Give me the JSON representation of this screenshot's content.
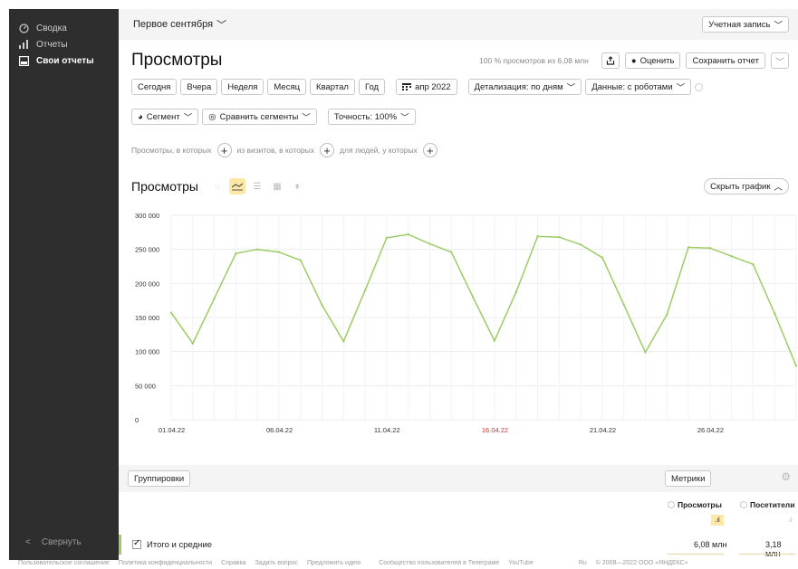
{
  "sidebar": {
    "items": [
      {
        "label": "Сводка",
        "icon": "dashboard-icon"
      },
      {
        "label": "Отчеты",
        "icon": "bar-chart-icon"
      },
      {
        "label": "Свои отчеты",
        "icon": "custom-report-icon"
      }
    ],
    "collapse_label": "Свернуть"
  },
  "header": {
    "period": "Первое сентября",
    "account_label": "Учетная запись"
  },
  "report": {
    "title": "Просмотры",
    "views_note": "100 % просмотров из 6,08 млн",
    "rate_label": "Оценить",
    "save_label": "Сохранить отчет"
  },
  "filters": {
    "periods": [
      "Сегодня",
      "Вчера",
      "Неделя",
      "Месяц",
      "Квартал",
      "Год"
    ],
    "date_label": "апр 2022",
    "detail_label": "Детализация: по дням",
    "data_label": "Данные: с роботами",
    "segment_label": "Сегмент",
    "compare_label": "Сравнить сегменты",
    "accuracy_label": "Точность: 100%",
    "cond_views": "Просмотры, в которых",
    "cond_visits": "из визитов, в которых",
    "cond_people": "для людей, у которых"
  },
  "chart_header": {
    "title": "Просмотры",
    "hide_label": "Скрыть график"
  },
  "chart_data": {
    "type": "line",
    "x": [
      "01.04.22",
      "02.04.22",
      "03.04.22",
      "04.04.22",
      "05.04.22",
      "06.04.22",
      "07.04.22",
      "08.04.22",
      "09.04.22",
      "10.04.22",
      "11.04.22",
      "12.04.22",
      "13.04.22",
      "14.04.22",
      "15.04.22",
      "16.04.22",
      "17.04.22",
      "18.04.22",
      "19.04.22",
      "20.04.22",
      "21.04.22",
      "22.04.22",
      "23.04.22",
      "24.04.22",
      "25.04.22",
      "26.04.22",
      "27.04.22",
      "28.04.22",
      "29.04.22",
      "30.04.22"
    ],
    "values": [
      157000,
      112000,
      178000,
      244000,
      250000,
      246000,
      234000,
      168000,
      115000,
      190000,
      267000,
      272000,
      258000,
      246000,
      180000,
      116000,
      187000,
      269000,
      268000,
      257000,
      238000,
      169000,
      99000,
      154000,
      253000,
      252000,
      240000,
      228000,
      156000,
      79000
    ],
    "x_tick_labels": [
      "01.04.22",
      "06.04.22",
      "11.04.22",
      "16.04.22",
      "21.04.22",
      "26.04.22"
    ],
    "highlight_tick": "16.04.22",
    "y_ticks": [
      "0",
      "50 000",
      "100 000",
      "150 000",
      "200 000",
      "250 000",
      "300 000"
    ],
    "ylim": [
      0,
      300000
    ],
    "grid": true,
    "line_color": "#9ccc65",
    "highlight_color": "#d32f2f"
  },
  "table": {
    "groupings_label": "Группировки",
    "metrics_label": "Метрики",
    "col_views": "Просмотры",
    "col_visitors": "Посетители",
    "totals_label": "Итого и средние",
    "total_views": "6,08 млн",
    "total_visitors": "3,18 млн"
  },
  "footer": {
    "links": [
      "Пользовательское соглашение",
      "Политика конфиденциальности",
      "Справка",
      "Задать вопрос",
      "Предложить идею",
      "Сообщество пользователей в Телеграме",
      "YouTube"
    ],
    "lang": "Ru",
    "copyright": "© 2008—2022 ООО «ЯНДЕКС»"
  }
}
